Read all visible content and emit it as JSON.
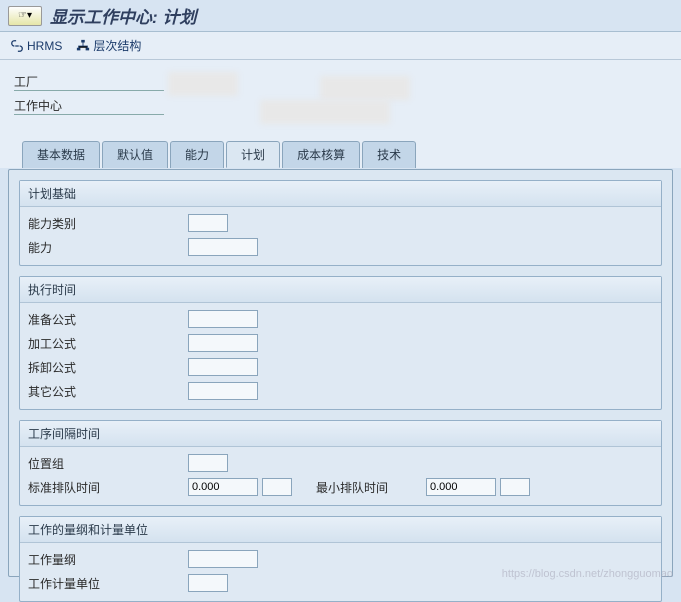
{
  "title": "显示工作中心: 计划",
  "toolbar": {
    "hrms": "HRMS",
    "hierarchy": "层次结构"
  },
  "header": {
    "plant_label": "工厂",
    "wc_label": "工作中心"
  },
  "tabs": [
    "基本数据",
    "默认值",
    "能力",
    "计划",
    "成本核算",
    "技术"
  ],
  "active_tab": 3,
  "groups": {
    "basis": {
      "title": "计划基础",
      "cap_cat": "能力类别",
      "capacity": "能力"
    },
    "exec": {
      "title": "执行时间",
      "setup": "准备公式",
      "process": "加工公式",
      "teardown": "拆卸公式",
      "other": "其它公式"
    },
    "interop": {
      "title": "工序间隔时间",
      "loc_group": "位置组",
      "std_queue": "标准排队时间",
      "std_val": "0.000",
      "min_queue": "最小排队时间",
      "min_val": "0.000"
    },
    "dim": {
      "title": "工作的量纲和计量单位",
      "work_dim": "工作量纲",
      "work_unit": "工作计量单位"
    }
  },
  "watermark": "https://blog.csdn.net/zhongguomao"
}
